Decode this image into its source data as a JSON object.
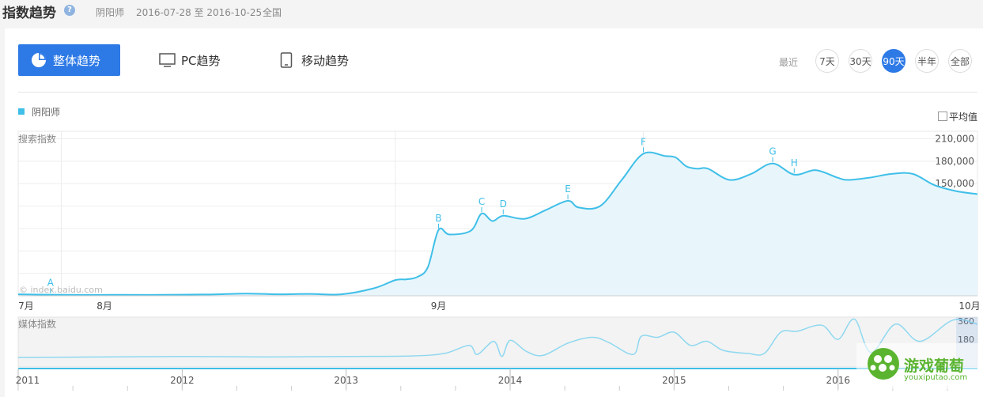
{
  "header": {
    "title": "指数趋势",
    "help_icon": "?",
    "keyword": "阴阳师",
    "date_range": "2016-07-28 至 2016-10-25",
    "region": "全国"
  },
  "tabs": [
    {
      "label": "整体趋势",
      "icon": "pie-chart-icon",
      "active": true
    },
    {
      "label": "PC趋势",
      "icon": "monitor-icon",
      "active": false
    },
    {
      "label": "移动趋势",
      "icon": "mobile-icon",
      "active": false
    }
  ],
  "range": {
    "label": "最近",
    "options": [
      "7天",
      "30天",
      "90天",
      "半年",
      "全部"
    ],
    "selected": "90天"
  },
  "legend": {
    "label": "阴阳师",
    "color": "#3fbfe8"
  },
  "average_toggle": {
    "label": "平均值",
    "checked": false
  },
  "colors": {
    "accent": "#2d7ae6",
    "series": "#3fbfe8"
  },
  "chart_data": [
    {
      "type": "area",
      "ylabel": "搜索指数",
      "watermark": "© index.baidu.com",
      "ylim": [
        0,
        220000
      ],
      "y_ticks": [
        "30,000",
        "60,000",
        "90,000",
        "120,000",
        "150,000",
        "180,000",
        "210,000"
      ],
      "x_labels": [
        "7月",
        "8月",
        "9月",
        "10月"
      ],
      "series": [
        {
          "name": "阴阳师",
          "x": [
            "2016-07-28",
            "2016-07-31",
            "2016-08-03",
            "2016-08-06",
            "2016-08-09",
            "2016-08-12",
            "2016-08-15",
            "2016-08-18",
            "2016-08-21",
            "2016-08-24",
            "2016-08-27",
            "2016-08-30",
            "2016-09-01",
            "2016-09-02",
            "2016-09-03",
            "2016-09-04",
            "2016-09-05",
            "2016-09-06",
            "2016-09-08",
            "2016-09-09",
            "2016-09-10",
            "2016-09-11",
            "2016-09-13",
            "2016-09-15",
            "2016-09-17",
            "2016-09-18",
            "2016-09-20",
            "2016-09-22",
            "2016-09-24",
            "2016-09-26",
            "2016-09-27",
            "2016-09-28",
            "2016-09-29",
            "2016-09-30",
            "2016-10-02",
            "2016-10-04",
            "2016-10-06",
            "2016-10-08",
            "2016-10-10",
            "2016-10-12",
            "2016-10-13",
            "2016-10-15",
            "2016-10-17",
            "2016-10-19",
            "2016-10-21",
            "2016-10-23",
            "2016-10-25"
          ],
          "values": [
            2000,
            1500,
            1200,
            1300,
            1200,
            1500,
            1800,
            3000,
            2000,
            2500,
            2000,
            10000,
            21000,
            22000,
            25000,
            38000,
            88000,
            82000,
            87000,
            110000,
            100000,
            107000,
            103000,
            115000,
            127000,
            118000,
            120000,
            155000,
            190000,
            187000,
            185000,
            173000,
            170000,
            170000,
            155000,
            163000,
            177000,
            162000,
            168000,
            158000,
            155000,
            158000,
            163000,
            163000,
            148000,
            140000,
            136000
          ]
        }
      ],
      "annotations": [
        {
          "label": "A",
          "x": "2016-07-31"
        },
        {
          "label": "B",
          "x": "2016-09-05"
        },
        {
          "label": "C",
          "x": "2016-09-09"
        },
        {
          "label": "D",
          "x": "2016-09-11"
        },
        {
          "label": "E",
          "x": "2016-09-17"
        },
        {
          "label": "F",
          "x": "2016-09-24"
        },
        {
          "label": "G",
          "x": "2016-10-06"
        },
        {
          "label": "H",
          "x": "2016-10-08"
        }
      ]
    },
    {
      "type": "line",
      "ylabel": "媒体指数",
      "y_ticks": [
        "360",
        "180"
      ],
      "x_labels": [
        "2011",
        "2012",
        "2013",
        "2014",
        "2015",
        "2016"
      ],
      "ylim": [
        0,
        400
      ],
      "series": [
        {
          "name": "阴阳师",
          "x": [
            2011.0,
            2011.5,
            2012.0,
            2012.5,
            2013.0,
            2013.4,
            2013.6,
            2013.75,
            2013.8,
            2013.9,
            2013.95,
            2014.0,
            2014.1,
            2014.2,
            2014.35,
            2014.5,
            2014.6,
            2014.75,
            2014.8,
            2014.9,
            2015.0,
            2015.1,
            2015.2,
            2015.3,
            2015.45,
            2015.55,
            2015.65,
            2015.75,
            2015.9,
            2016.0,
            2016.1,
            2016.2,
            2016.35,
            2016.5,
            2016.7,
            2016.85
          ],
          "values": [
            0,
            5,
            10,
            5,
            10,
            15,
            40,
            120,
            30,
            160,
            10,
            170,
            60,
            20,
            140,
            200,
            150,
            30,
            210,
            200,
            250,
            120,
            160,
            70,
            40,
            40,
            250,
            260,
            320,
            180,
            380,
            50,
            330,
            160,
            370,
            330
          ]
        }
      ]
    }
  ],
  "watermark_brand": {
    "name": "游戏葡萄",
    "url": "youxiputao.com"
  }
}
